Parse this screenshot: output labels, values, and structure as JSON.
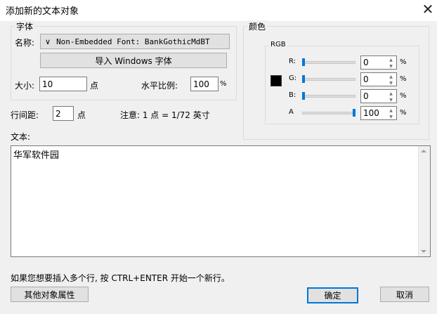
{
  "dialog": {
    "title": "添加新的文本对象",
    "close_glyph": "✕"
  },
  "font_group": {
    "legend": "字体",
    "name_label": "名称:",
    "font_value": "Non-Embedded Font: BankGothicMdBT",
    "dropdown_glyph": "∨",
    "import_button": "导入 Windows 字体",
    "size_label": "大小:",
    "size_value": "10",
    "size_unit": "点",
    "hscale_label": "水平比例:",
    "hscale_value": "100",
    "hscale_unit": "%"
  },
  "color_group": {
    "legend": "颜色",
    "rgb_legend": "RGB",
    "swatch_color": "#000000",
    "channels": [
      {
        "label": "R:",
        "value": "0",
        "unit": "%",
        "level": 0
      },
      {
        "label": "G:",
        "value": "0",
        "unit": "%",
        "level": 0
      },
      {
        "label": "B:",
        "value": "0",
        "unit": "%",
        "level": 0
      },
      {
        "label": "A",
        "value": "100",
        "unit": "%",
        "level": 100
      }
    ]
  },
  "line_spacing": {
    "label": "行间距:",
    "value": "2",
    "unit": "点"
  },
  "note": "注意: 1 点 = 1/72 英寸",
  "text_section": {
    "label": "文本:",
    "content": "华军软件园"
  },
  "hint": "如果您想要插入多个行, 按 CTRL+ENTER 开始一个新行。",
  "buttons": {
    "other_props": "其他对象属性",
    "ok": "确定",
    "cancel": "取消"
  }
}
